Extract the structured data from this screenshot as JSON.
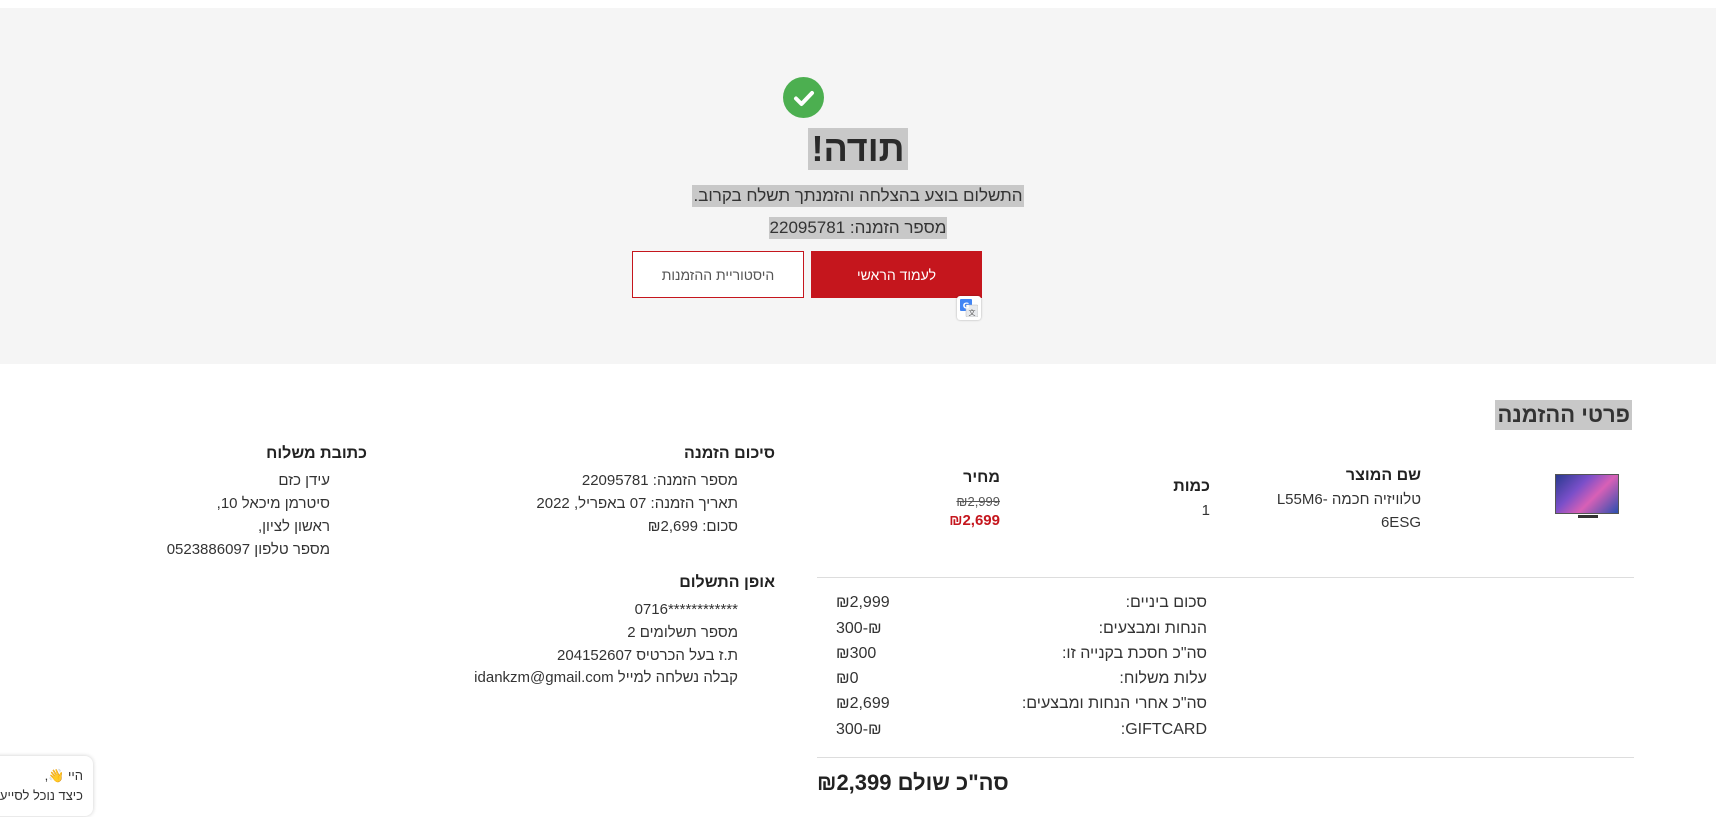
{
  "hero": {
    "title": "תודה!",
    "message": "התשלום בוצע בהצלחה והזמנתך תשלח בקרוב.",
    "order_number_line": "מספר הזמנה: 22095781",
    "home_button": "לעמוד הראשי",
    "history_button": "היסטוריית ההזמנות",
    "colors": {
      "accent": "#c5161d",
      "success": "#4caf50"
    }
  },
  "order_details": {
    "title": "פרטי ההזמנה",
    "columns": {
      "product": "שם המוצר",
      "quantity": "כמות",
      "price": "מחיר"
    },
    "item": {
      "name_line1": "טלוויזיה חכמה -L55M6",
      "name_line2": "6ESG",
      "quantity": "1",
      "old_price": "₪2,999",
      "price": "₪2,699"
    },
    "summary": [
      {
        "label": "סכום ביניים:",
        "value": "₪2,999"
      },
      {
        "label": "הנחות ומבצעים:",
        "value": "₪-300"
      },
      {
        "label": "סה\"כ חסכת בקנייה זו:",
        "value": "₪300"
      },
      {
        "label": "עלות משלוח:",
        "value": "₪0"
      },
      {
        "label": "סה\"כ אחרי הנחות ומבצעים:",
        "value": "₪2,699"
      },
      {
        "label": "GIFTCARD:",
        "value": "₪-300"
      }
    ],
    "total": "סה\"כ שולם ₪2,399"
  },
  "order_summary": {
    "title": "סיכום הזמנה",
    "lines": [
      "מספר הזמנה: 22095781",
      "תאריך הזמנה: 07 באפריל, 2022",
      "סכום: ₪2,699"
    ]
  },
  "shipping": {
    "title": "כתובת משלוח",
    "lines": [
      "עידן כזם",
      "סיטרמן מיכאל 10,",
      "ראשון לציון,",
      "מספר טלפון 0523886097"
    ]
  },
  "payment": {
    "title": "אופן התשלום",
    "lines": [
      "************0716",
      "מספר תשלומים 2",
      "ת.ז בעל הכרטיס 204152607",
      "קבלה נשלחה למייל idankzm@gmail.com"
    ]
  },
  "chat": {
    "line1": "היי 👋,",
    "line2": "כיצד נוכל לסייע לך"
  }
}
